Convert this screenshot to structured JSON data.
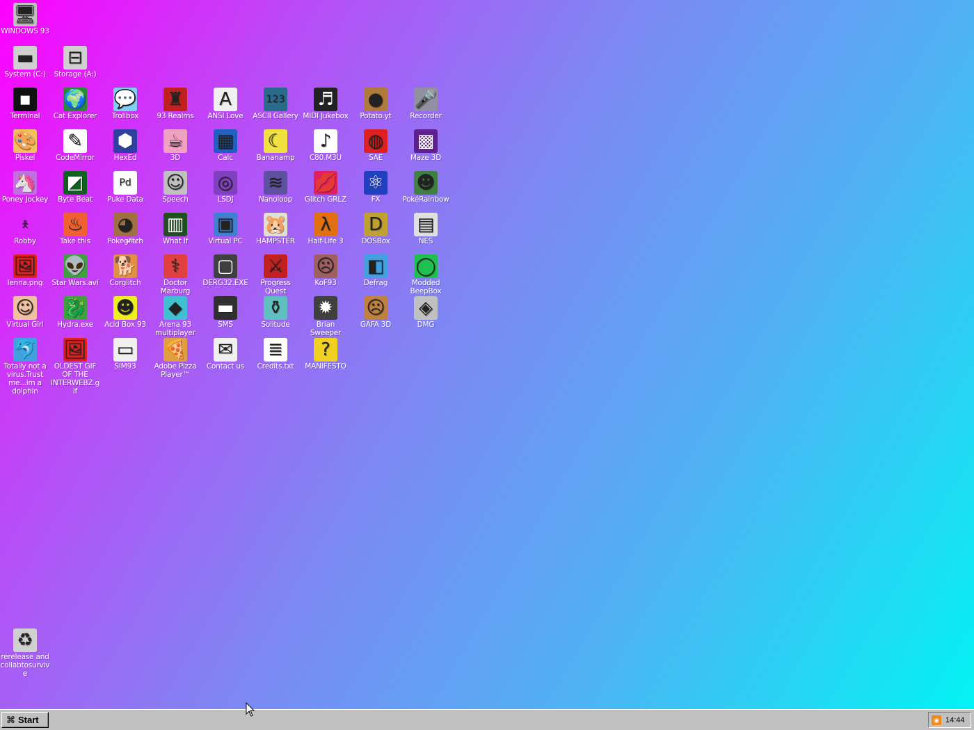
{
  "desktop": {
    "icons": [
      {
        "label": "WINDOWS 93",
        "icon": "computer-icon",
        "glyph": "🖥",
        "bg": "#c0c0c0"
      },
      {
        "label": "System (C:)",
        "icon": "hard-drive-icon",
        "glyph": "▬",
        "bg": "#d0d0d0"
      },
      {
        "label": "Storage (A:)",
        "icon": "floppy-drive-icon",
        "glyph": "⊟",
        "bg": "#d0d0d0"
      },
      {
        "label": "Terminal",
        "icon": "terminal-icon",
        "glyph": "▪",
        "bg": "#111111"
      },
      {
        "label": "Cat Explorer",
        "icon": "globe-cat-icon",
        "glyph": "🌍",
        "bg": "#2a8a3a"
      },
      {
        "label": "Trollbox",
        "icon": "chat-bubble-icon",
        "glyph": "💬",
        "bg": "#7fd0f0"
      },
      {
        "label": "93 Realms",
        "icon": "realms-icon",
        "glyph": "♜",
        "bg": "#c02020"
      },
      {
        "label": "ANSI Love",
        "icon": "ansi-letter-icon",
        "glyph": "A",
        "bg": "#f0f0f0"
      },
      {
        "label": "ASCII Gallery",
        "icon": "ascii-numbers-icon",
        "glyph": "123",
        "bg": "#2a6a8a"
      },
      {
        "label": "MIDI Jukebox",
        "icon": "piano-keys-icon",
        "glyph": "♬",
        "bg": "#222222"
      },
      {
        "label": "Potato.yt",
        "icon": "potato-icon",
        "glyph": "●",
        "bg": "#b07a3a"
      },
      {
        "label": "Recorder",
        "icon": "microphone-icon",
        "glyph": "🎤",
        "bg": "#9090a0"
      },
      {
        "label": "Piskel",
        "icon": "palette-icon",
        "glyph": "🎨",
        "bg": "#f0c060"
      },
      {
        "label": "CodeMirror",
        "icon": "codemirror-icon",
        "glyph": "✎",
        "bg": "#ffffff"
      },
      {
        "label": "HexEd",
        "icon": "hex-cube-icon",
        "glyph": "⬢",
        "bg": "#3040a0"
      },
      {
        "label": "3D",
        "icon": "teapot-icon",
        "glyph": "☕",
        "bg": "#f0a0c0"
      },
      {
        "label": "Calc",
        "icon": "calculator-icon",
        "glyph": "▦",
        "bg": "#2060c0"
      },
      {
        "label": "Bananamp",
        "icon": "banana-icon",
        "glyph": "☾",
        "bg": "#f0e040"
      },
      {
        "label": "C80.M3U",
        "icon": "playlist-file-icon",
        "glyph": "♪",
        "bg": "#ffffff"
      },
      {
        "label": "SAE",
        "icon": "amiga-ball-icon",
        "glyph": "◍",
        "bg": "#e02020"
      },
      {
        "label": "Maze 3D",
        "icon": "maze-icon",
        "glyph": "▩",
        "bg": "#602090"
      },
      {
        "label": "Poney Jockey",
        "icon": "pony-icon",
        "glyph": "🦄",
        "bg": "#c070e0"
      },
      {
        "label": "Byte Beat",
        "icon": "byte-beat-icon",
        "glyph": "◩",
        "bg": "#106020"
      },
      {
        "label": "Puke Data",
        "icon": "pd-icon",
        "glyph": "Pd",
        "bg": "#ffffff"
      },
      {
        "label": "Speech",
        "icon": "face-icon",
        "glyph": "☺",
        "bg": "#c0c0c0"
      },
      {
        "label": "LSDJ",
        "icon": "lsdj-icon",
        "glyph": "◎",
        "bg": "#8040c0"
      },
      {
        "label": "Nanoloop",
        "icon": "nanoloop-icon",
        "glyph": "≋",
        "bg": "#6050a0"
      },
      {
        "label": "Glitch GRLZ",
        "icon": "lips-icon",
        "glyph": "💋",
        "bg": "#e02060"
      },
      {
        "label": "FX",
        "icon": "atom-icon",
        "glyph": "⚛",
        "bg": "#2040c0"
      },
      {
        "label": "PokéRainbow",
        "icon": "people-group-icon",
        "glyph": "☻",
        "bg": "#408040"
      },
      {
        "label": "Robby",
        "icon": "stick-figure-icon",
        "glyph": "🯅",
        "bg": "transparent"
      },
      {
        "label": "Take this",
        "icon": "take-this-icon",
        "glyph": "♨",
        "bg": "#f06030"
      },
      {
        "label": "Pokeg̵l̶i̸t̵c̷h",
        "icon": "poke-glitch-icon",
        "glyph": "◕",
        "bg": "#a07040"
      },
      {
        "label": "What If",
        "icon": "what-if-icon",
        "glyph": "▥",
        "bg": "#205020"
      },
      {
        "label": "Virtual PC",
        "icon": "virtual-pc-icon",
        "glyph": "▣",
        "bg": "#4080d0"
      },
      {
        "label": "HAMPSTER",
        "icon": "hamster-icon",
        "glyph": "🐹",
        "bg": "#e0e0d0"
      },
      {
        "label": "Half-Life 3",
        "icon": "lambda-icon",
        "glyph": "λ",
        "bg": "#e07010"
      },
      {
        "label": "DOSBox",
        "icon": "dosbox-icon",
        "glyph": "D",
        "bg": "#c0a030"
      },
      {
        "label": "NES",
        "icon": "nes-console-icon",
        "glyph": "▤",
        "bg": "#e0e0e0"
      },
      {
        "label": "lenna.png",
        "icon": "image-file-icon",
        "glyph": "🖼",
        "bg": "#e02020"
      },
      {
        "label": "Star Wars.avi",
        "icon": "yoda-icon",
        "glyph": "👽",
        "bg": "#40a040"
      },
      {
        "label": "Corglitch",
        "icon": "corgi-icon",
        "glyph": "🐕",
        "bg": "#e09040"
      },
      {
        "label": "Doctor Marburg",
        "icon": "doctor-icon",
        "glyph": "⚕",
        "bg": "#e04040"
      },
      {
        "label": "DERG32.EXE",
        "icon": "derg-monitor-icon",
        "glyph": "▢",
        "bg": "#404040"
      },
      {
        "label": "Progress Quest",
        "icon": "crossed-swords-icon",
        "glyph": "⚔",
        "bg": "#c02020"
      },
      {
        "label": "KoF93",
        "icon": "fighter-portrait-icon",
        "glyph": "☹",
        "bg": "#a06060"
      },
      {
        "label": "Defrag",
        "icon": "defrag-icon",
        "glyph": "◧",
        "bg": "#40a0e0"
      },
      {
        "label": "Modded BeepBox",
        "icon": "ring-icon",
        "glyph": "◯",
        "bg": "#20c050"
      },
      {
        "label": "Virtual Girl",
        "icon": "girl-face-icon",
        "glyph": "☺",
        "bg": "#f0c0a0"
      },
      {
        "label": "Hydra.exe",
        "icon": "hydra-icon",
        "glyph": "🐉",
        "bg": "#40a040"
      },
      {
        "label": "Acid Box 93",
        "icon": "smiley-icon",
        "glyph": "☻",
        "bg": "#f0f020"
      },
      {
        "label": "Arena 93 multiplayer",
        "icon": "cube-icon",
        "glyph": "◆",
        "bg": "#40c0d0"
      },
      {
        "label": "SMS",
        "icon": "sms-console-icon",
        "glyph": "▬",
        "bg": "#303030"
      },
      {
        "label": "Solitude",
        "icon": "bottle-icon",
        "glyph": "⚱",
        "bg": "#60c0c0"
      },
      {
        "label": "Brian Sweeper",
        "icon": "mine-icon",
        "glyph": "✹",
        "bg": "#404040"
      },
      {
        "label": "GAFA 3D",
        "icon": "gafa-face-icon",
        "glyph": "☹",
        "bg": "#c08040"
      },
      {
        "label": "DMG",
        "icon": "dmg-disk-icon",
        "glyph": "◈",
        "bg": "#c0c0c0"
      },
      {
        "label": "Totally not a virus.Trust me...im a dolphin",
        "icon": "dolphin-icon",
        "glyph": "🐬",
        "bg": "#40a0e0"
      },
      {
        "label": "OLDEST GIF OF THE INTERWEBZ.gif",
        "icon": "gif-file-icon",
        "glyph": "🖼",
        "bg": "#e02020"
      },
      {
        "label": "SIM93",
        "icon": "sim-book-icon",
        "glyph": "▭",
        "bg": "#f0f0f0"
      },
      {
        "label": "Adobe Pizza Player™",
        "icon": "pizza-icon",
        "glyph": "🍕",
        "bg": "#e0a040"
      },
      {
        "label": "Contact us",
        "icon": "contact-edit-icon",
        "glyph": "✉",
        "bg": "#f0f0f0"
      },
      {
        "label": "Credits.txt",
        "icon": "text-file-icon",
        "glyph": "≣",
        "bg": "#ffffff"
      },
      {
        "label": "MANIFESTO",
        "icon": "question-mark-icon",
        "glyph": "?",
        "bg": "#f0d020"
      },
      {
        "label": "rerelease and collabtosurvive",
        "icon": "recycle-bin-icon",
        "glyph": "♻",
        "bg": "#d0d0d0"
      }
    ]
  },
  "taskbar": {
    "start_label": "Start",
    "clock": "14:44",
    "rss_glyph": "◉"
  }
}
